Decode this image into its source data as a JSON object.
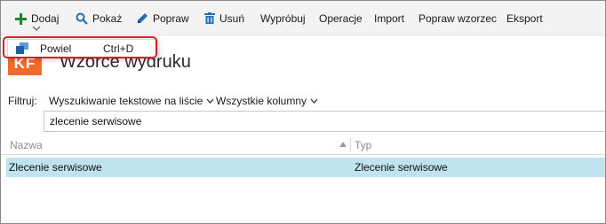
{
  "toolbar": {
    "items": [
      {
        "label": "Dodaj",
        "icon": "plus-icon"
      },
      {
        "label": "Pokaż",
        "icon": "search-icon"
      },
      {
        "label": "Popraw",
        "icon": "edit-icon"
      },
      {
        "label": "Usuń",
        "icon": "trash-icon"
      },
      {
        "label": "Wypróbuj"
      },
      {
        "label": "Operacje"
      },
      {
        "label": "Import"
      },
      {
        "label": "Popraw wzorzec"
      },
      {
        "label": "Eksport"
      }
    ]
  },
  "popup_menu": {
    "items": [
      {
        "label": "Powiel",
        "shortcut": "Ctrl+D",
        "icon": "duplicate-icon"
      }
    ]
  },
  "page": {
    "logo_text": "KF",
    "title": "Wzorce wydruku"
  },
  "filter": {
    "label": "Filtruj:",
    "mode": "Wyszukiwanie tekstowe na liście",
    "columns": "Wszystkie kolumny",
    "search_value": "zlecenie serwisowe"
  },
  "grid": {
    "columns": [
      "Nazwa",
      "Typ"
    ],
    "rows": [
      [
        "Zlecenie serwisowe",
        "Zlecenie serwisowe"
      ]
    ]
  },
  "colors": {
    "toolbar_bg": "#f3f3f3",
    "accent_green": "#1a8a2e",
    "accent_blue": "#1d6fb8",
    "logo_orange": "#f06b2d",
    "selection": "#bfe3ef",
    "highlight_red": "#d4202a"
  }
}
